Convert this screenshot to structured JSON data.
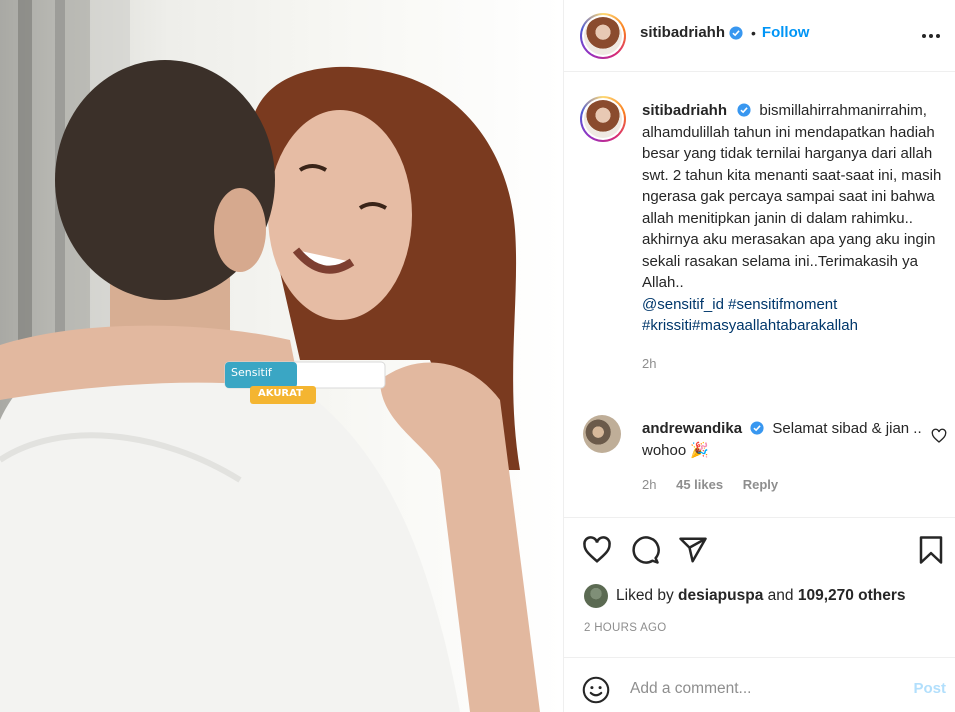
{
  "post": {
    "username": "sitibadriahh",
    "follow_label": "Follow",
    "dot_separator": "•",
    "caption_text": "bismillahirrahmanirrahim, alhamdulillah tahun ini mendapatkan hadiah besar yang tidak ternilai harganya dari allah swt. 2 tahun kita menanti saat-saat ini, masih ngerasa gak percaya sampai saat ini bahwa allah menitipkan janin di dalam rahimku.. akhirnya aku merasakan apa yang aku ingin sekali rasakan selama ini..Terimakasih ya Allah..",
    "mention": "@sensitif_id",
    "hashtag1": "#sensitifmoment",
    "hashtag2": "#krissiti",
    "hashtag3": "#masyaallahtabarakallah",
    "caption_time": "2h"
  },
  "product_labels": {
    "brand": "Sensitif",
    "badge": "AKURAT"
  },
  "comment": {
    "username": "andrewandika",
    "text": "Selamat sibad & jian .. wohoo",
    "emoji": "🎉",
    "time": "2h",
    "likes": "45 likes",
    "reply_label": "Reply"
  },
  "likes": {
    "prefix": "Liked by",
    "liker": "desiapuspa",
    "and": "and",
    "others": "109,270 others"
  },
  "timestamp": "2 HOURS AGO",
  "add_comment": {
    "placeholder": "Add a comment...",
    "post_label": "Post"
  },
  "colors": {
    "link_blue": "#0095f6",
    "tag_blue": "#00376b",
    "muted": "#8e8e8e",
    "post_disabled": "#b2dffc"
  },
  "icons": {
    "header": [
      "verified-badge-icon",
      "more-options-icon"
    ],
    "actions": [
      "heart-icon",
      "comment-icon",
      "share-icon",
      "bookmark-icon"
    ],
    "comment": [
      "heart-icon",
      "party-popper-icon"
    ],
    "input": [
      "emoji-icon"
    ]
  }
}
